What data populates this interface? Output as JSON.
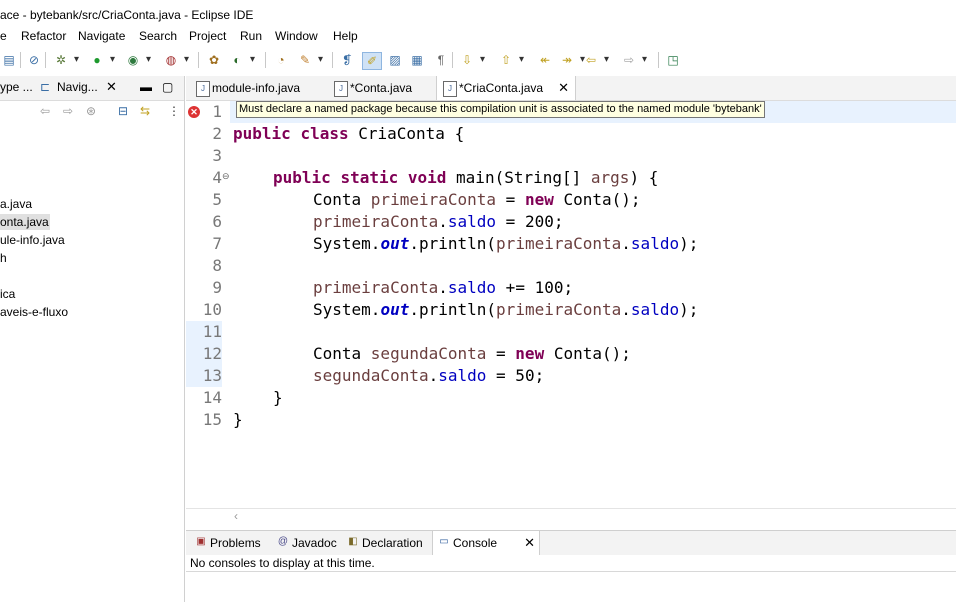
{
  "window": {
    "title": "ace - bytebank/src/CriaConta.java - Eclipse IDE"
  },
  "menu": [
    "e",
    "Refactor",
    "Navigate",
    "Search",
    "Project",
    "Run",
    "Window",
    "Help"
  ],
  "left_panel": {
    "tab1": "ype ...",
    "tab2": "Navig...",
    "items": [
      "a.java",
      "onta.java",
      "ule-info.java",
      "h",
      "ica",
      "aveis-e-fluxo"
    ]
  },
  "editor_tabs": [
    {
      "label": "module-info.java"
    },
    {
      "label": "*Conta.java"
    },
    {
      "label": "*CriaConta.java"
    }
  ],
  "tooltip": "Must declare a named package because this compilation unit is associated to the named module 'bytebank'",
  "line_numbers": [
    "1",
    "2",
    "3",
    "4",
    "5",
    "6",
    "7",
    "8",
    "9",
    "10",
    "11",
    "12",
    "13",
    "14",
    "15"
  ],
  "code": {
    "l2_kw1": "public",
    "l2_kw2": "class",
    "l2_rest": " CriaConta {",
    "l4_kw1": "public",
    "l4_kw2": "static",
    "l4_kw3": "void",
    "l4_m": " main(String[] ",
    "l4_arg": "args",
    "l4_end": ") {",
    "l5_t": "Conta ",
    "l5_v": "primeiraConta",
    "l5_eq": " = ",
    "l5_new": "new",
    "l5_end": " Conta();",
    "l6_v": "primeiraConta",
    "l6_dot": ".",
    "l6_f": "saldo",
    "l6_end": " = 200;",
    "l7_a": "System.",
    "l7_out": "out",
    "l7_b": ".println(",
    "l7_v": "primeiraConta",
    "l7_dot": ".",
    "l7_f": "saldo",
    "l7_end": ");",
    "l9_v": "primeiraConta",
    "l9_dot": ".",
    "l9_f": "saldo",
    "l9_end": " += 100;",
    "l10_a": "System.",
    "l10_out": "out",
    "l10_b": ".println(",
    "l10_v": "primeiraConta",
    "l10_dot": ".",
    "l10_f": "saldo",
    "l10_end": ");",
    "l12_t": "Conta ",
    "l12_v": "segundaConta",
    "l12_eq": " = ",
    "l12_new": "new",
    "l12_end": " Conta();",
    "l13_v": "segundaConta",
    "l13_dot": ".",
    "l13_f": "saldo",
    "l13_end": " = 50;",
    "l14": "}",
    "l15": "}"
  },
  "bottom_tabs": [
    {
      "label": "Problems"
    },
    {
      "label": "Javadoc"
    },
    {
      "label": "Declaration"
    },
    {
      "label": "Console"
    }
  ],
  "console_text": "No consoles to display at this time.",
  "colors": {
    "keyword": "#7f0055",
    "field": "#0000c0",
    "variable": "#6a3e3e",
    "line_highlight": "#e8f2fe",
    "tooltip_bg": "#ffffe1"
  }
}
